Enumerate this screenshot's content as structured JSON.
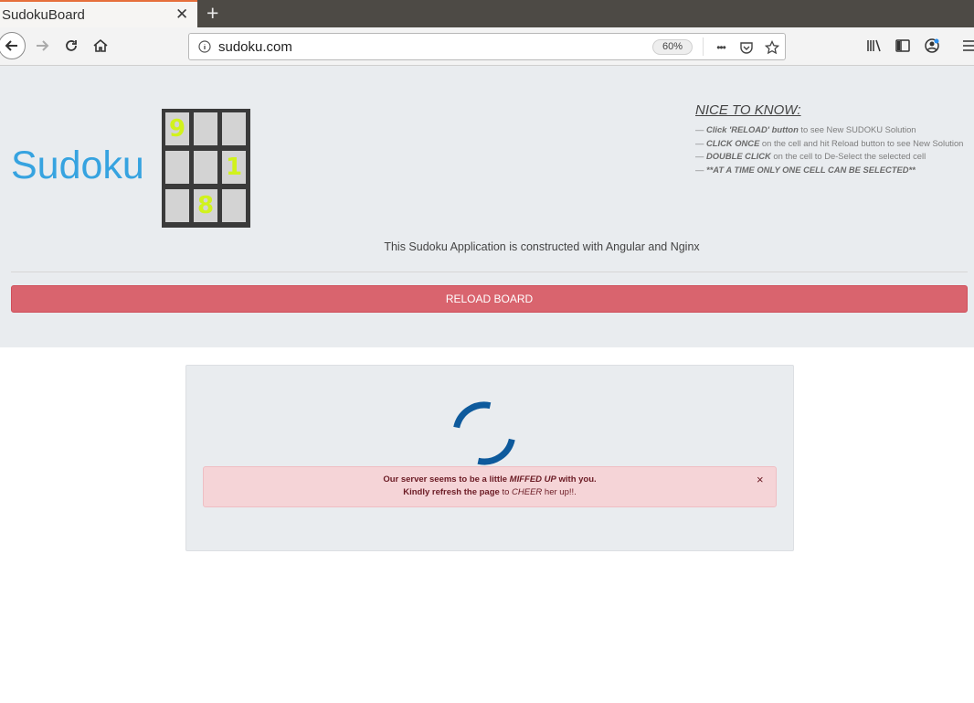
{
  "browser": {
    "tab_title": "SudokuBoard",
    "tab_close": "✕",
    "new_tab": "+",
    "url": "sudoku.com",
    "zoom": "60%",
    "url_menu": "•••"
  },
  "page": {
    "brand": "Sudoku",
    "logo_cells": [
      "9",
      "",
      "",
      "",
      "",
      "1",
      "",
      "8",
      ""
    ],
    "nice_title": "NICE TO KNOW:",
    "tips": [
      {
        "bold": "Click 'RELOAD' button",
        "text": " to see New SUDOKU Solution"
      },
      {
        "bold": "CLICK ONCE",
        "text": " on the cell and hit Reload button to see New Solution"
      },
      {
        "bold": "DOUBLE CLICK",
        "text": " on the cell to De-Select the selected cell"
      },
      {
        "bold": "**AT A TIME ONLY ONE CELL CAN BE SELECTED**",
        "text": ""
      }
    ],
    "tip_prefix": "— ",
    "subtitle": "This Sudoku Application is constructed with Angular and Nginx",
    "reload_button": "RELOAD BOARD"
  },
  "alert": {
    "line1_a": "Our server seems to be a little ",
    "line1_b": "MIFFED UP",
    "line1_c": " with you.",
    "line2_a": "Kindly refresh the page",
    "line2_b": " to ",
    "line2_c": "CHEER",
    "line2_d": " her up!!.",
    "close": "×"
  },
  "colors": {
    "brand": "#36a3e0",
    "reload": "#d9646e",
    "spinner": "#0e5a9c",
    "alert_bg": "#f5d4d7",
    "logo_digit": "#d1f21c"
  }
}
